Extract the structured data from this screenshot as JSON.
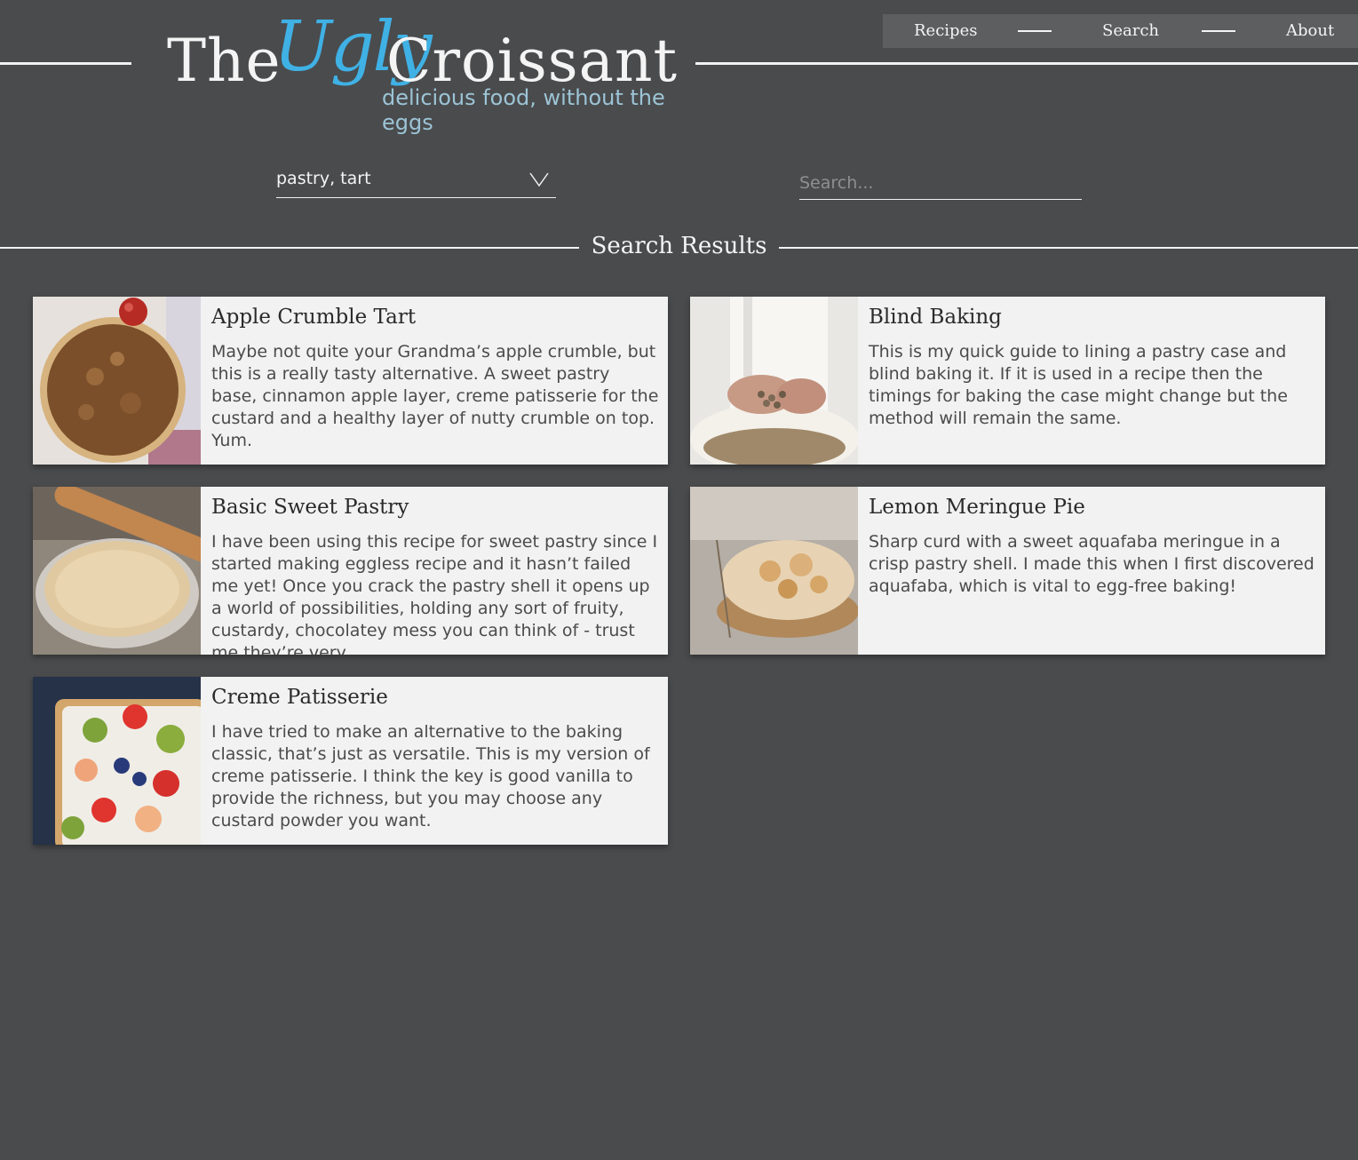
{
  "logo": {
    "the": "The",
    "ugly": "Ugly",
    "croissant": "Croissant",
    "tagline": "delicious food, without the eggs"
  },
  "nav": {
    "recipes": "Recipes",
    "search": "Search",
    "about": "About"
  },
  "filters": {
    "selected": "pastry, tart",
    "search_placeholder": "Search..."
  },
  "results_heading": "Search Results",
  "colors": {
    "background": "#4a4b4d",
    "accent": "#3fb1e5",
    "card": "#f2f2f2"
  },
  "results": [
    {
      "title": "Apple Crumble Tart",
      "description": "Maybe not quite your Grandma’s apple crumble, but this is a really tasty alternative. A sweet pastry base, cinnamon apple layer, creme patisserie for the custard and a healthy layer of nutty crumble on top. Yum."
    },
    {
      "title": "Blind Baking",
      "description": "This is my quick guide to lining a pastry case and blind baking it. If it is used in a recipe then the timings for baking the case might change but the method will remain the same."
    },
    {
      "title": "Basic Sweet Pastry",
      "description": "I have been using this recipe for sweet pastry since I started making eggless recipe and it hasn’t failed me yet! Once you crack the pastry shell it opens up a world of possibilities, holding any sort of fruity, custardy, chocolatey mess you can think of - trust me they’re very"
    },
    {
      "title": "Lemon Meringue Pie",
      "description": "Sharp curd with a sweet aquafaba meringue in a crisp pastry shell. I made this when I first discovered aquafaba, which is vital to egg-free baking!"
    },
    {
      "title": "Creme Patisserie",
      "description": "I have tried to make an alternative to the baking classic, that’s just as versatile. This is my version of creme patisserie. I think the key is good vanilla to provide the richness, but you may choose any custard powder you want."
    }
  ]
}
